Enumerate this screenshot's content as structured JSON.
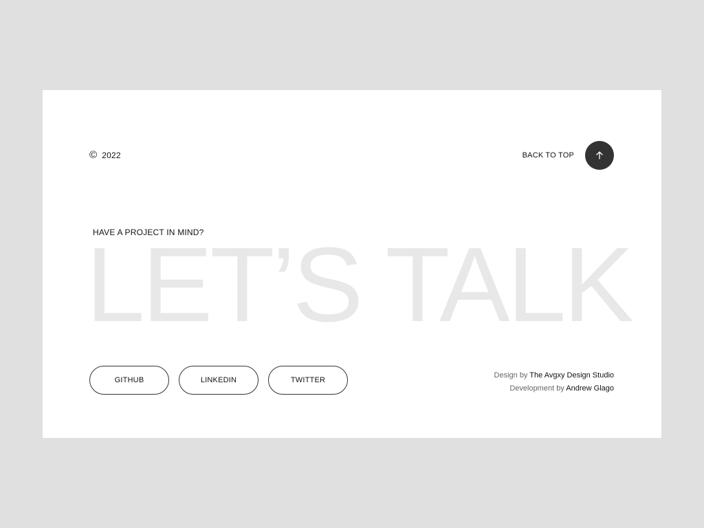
{
  "header": {
    "copyright_symbol": "©",
    "year": "2022",
    "back_to_top_label": "BACK TO TOP",
    "back_to_top_icon": "arrow-up-icon"
  },
  "hero": {
    "tagline": "HAVE A PROJECT IN MIND?",
    "headline": "LET’S TALK"
  },
  "socials": [
    {
      "label": "GITHUB"
    },
    {
      "label": "LINKEDIN"
    },
    {
      "label": "TWITTER"
    }
  ],
  "credits": {
    "design_prefix": "Design by",
    "design_name": "The Avgxy Design Studio",
    "dev_prefix": "Development by",
    "dev_name": "Andrew Glago"
  },
  "colors": {
    "background": "#e0e0e0",
    "card": "#ffffff",
    "button_dark": "#333333",
    "headline": "#e8e8e8"
  }
}
